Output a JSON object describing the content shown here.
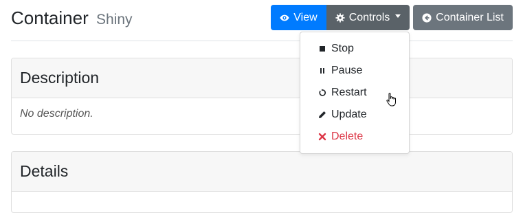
{
  "header": {
    "title": "Container",
    "subtitle": "Shiny"
  },
  "toolbar": {
    "view_label": "View",
    "controls_label": "Controls",
    "list_label": "Container List"
  },
  "controls_menu": {
    "items": [
      {
        "label": "Stop",
        "icon": "stop-icon"
      },
      {
        "label": "Pause",
        "icon": "pause-icon"
      },
      {
        "label": "Restart",
        "icon": "restart-icon"
      },
      {
        "label": "Update",
        "icon": "pencil-icon"
      },
      {
        "label": "Delete",
        "icon": "close-icon"
      }
    ]
  },
  "description_card": {
    "title": "Description",
    "body": "No description."
  },
  "details_card": {
    "title": "Details"
  },
  "colors": {
    "primary": "#007bff",
    "secondary": "#6c757d",
    "danger": "#dc3545"
  }
}
